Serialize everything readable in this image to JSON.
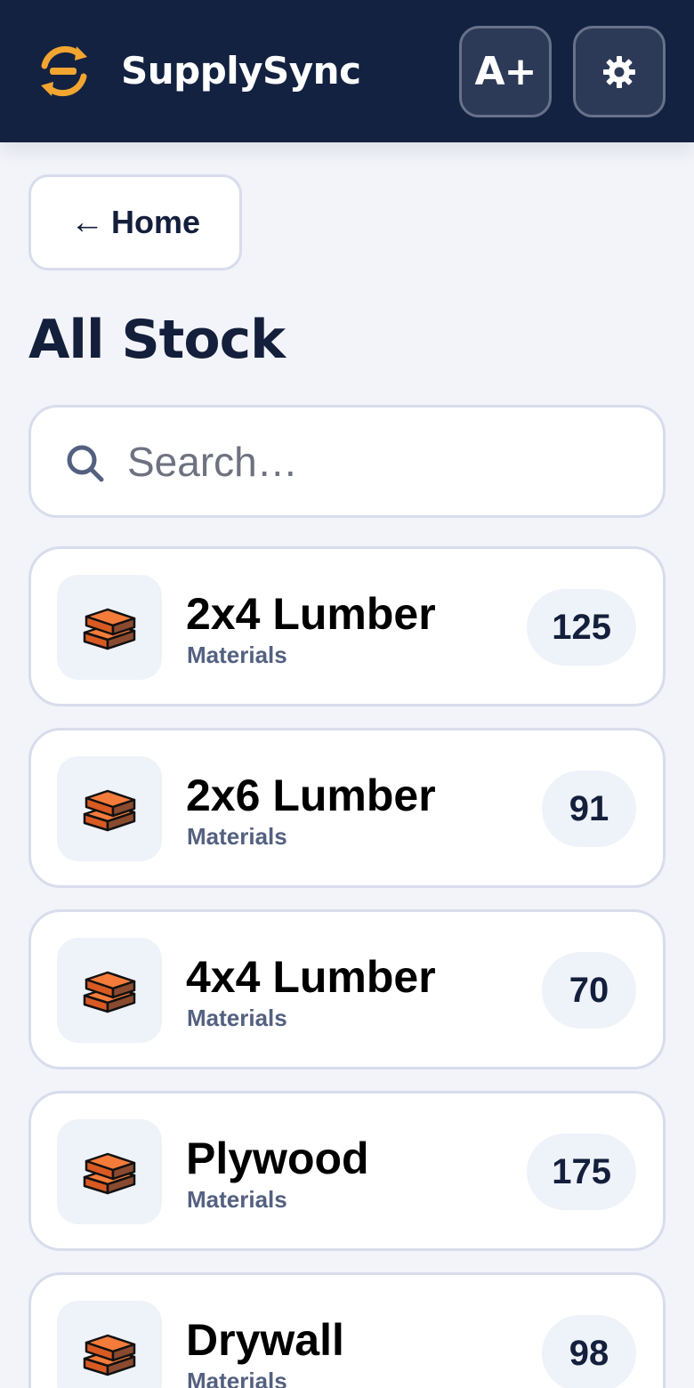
{
  "app": {
    "title": "SupplySync",
    "accent_color": "#f2a530",
    "header_bg": "#142241",
    "logo_icon": "sync-icon"
  },
  "header": {
    "text_size_label": "A+",
    "settings_icon": "gear-icon"
  },
  "nav": {
    "home_arrow": "←",
    "home_label": "Home"
  },
  "page": {
    "title": "All Stock"
  },
  "search": {
    "placeholder": "Search…",
    "value": "",
    "icon": "search-icon"
  },
  "items": [
    {
      "name": "2x4 Lumber",
      "category": "Materials",
      "quantity": "125",
      "icon": "lumber-icon"
    },
    {
      "name": "2x6 Lumber",
      "category": "Materials",
      "quantity": "91",
      "icon": "lumber-icon"
    },
    {
      "name": "4x4 Lumber",
      "category": "Materials",
      "quantity": "70",
      "icon": "lumber-icon"
    },
    {
      "name": "Plywood",
      "category": "Materials",
      "quantity": "175",
      "icon": "lumber-icon"
    },
    {
      "name": "Drywall",
      "category": "Materials",
      "quantity": "98",
      "icon": "lumber-icon"
    }
  ]
}
